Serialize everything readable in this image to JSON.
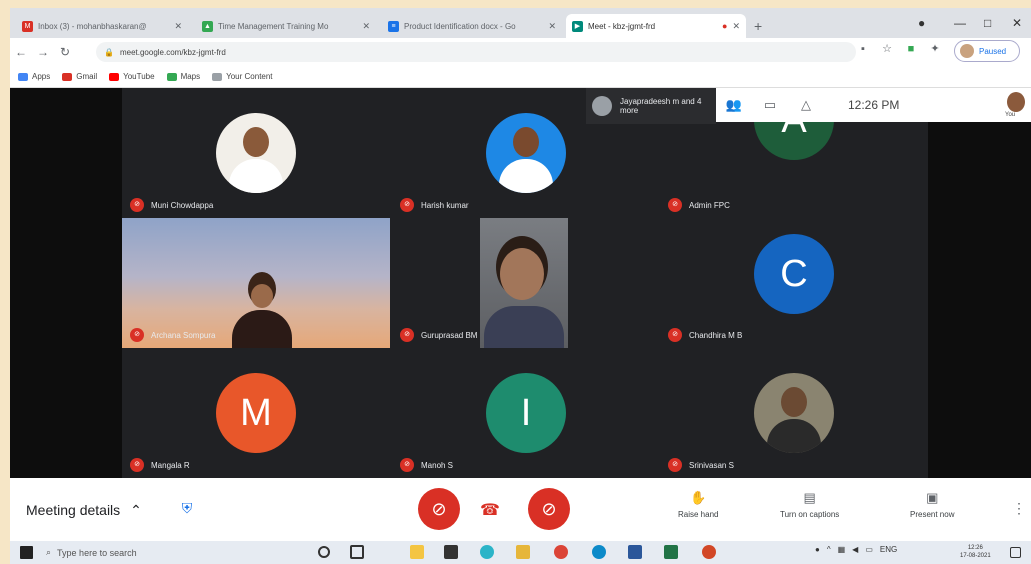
{
  "browser": {
    "tabs": [
      {
        "label": "Inbox (3) - mohanbhaskaran@",
        "icon": "gmail-icon",
        "color": "#d93025"
      },
      {
        "label": "Time Management Training Mo",
        "icon": "drive-icon",
        "color": "#34a853"
      },
      {
        "label": "Product Identification docx - Go",
        "icon": "docs-icon",
        "color": "#1a73e8"
      },
      {
        "label": "Meet - kbz-jgmt-frd",
        "icon": "meet-icon",
        "color": "#00897b"
      }
    ],
    "url": "meet.google.com/kbz-jgmt-frd",
    "profile_label": "Paused",
    "bookmarks": [
      {
        "label": "Apps",
        "color": "#4285f4"
      },
      {
        "label": "Gmail",
        "color": "#d93025"
      },
      {
        "label": "YouTube",
        "color": "#ff0000"
      },
      {
        "label": "Maps",
        "color": "#34a853"
      },
      {
        "label": "Your Content",
        "color": "#9aa0a6"
      }
    ]
  },
  "meet": {
    "participants_toast": "Jayapradeesh m and 4 more",
    "time": "12:26 PM",
    "self_label": "You",
    "tiles": [
      {
        "name": "Muni Chowdappa",
        "type": "photo",
        "color": "#f2efe9",
        "skin": "#8a5a3a",
        "shirt": "#ffffff"
      },
      {
        "name": "Harish kumar",
        "type": "photo",
        "color": "#1e88e5",
        "skin": "#7a4a2e",
        "shirt": "#ffffff"
      },
      {
        "name": "Admin FPC",
        "type": "letter",
        "letter": "A",
        "color": "#1e5d3a"
      },
      {
        "name": "Archana Sompura",
        "type": "sunset"
      },
      {
        "name": "Guruprasad BM",
        "type": "camera"
      },
      {
        "name": "Chandhira M B",
        "type": "letter",
        "letter": "C",
        "color": "#1565c0"
      },
      {
        "name": "Mangala R",
        "type": "letter",
        "letter": "M",
        "color": "#e8572a"
      },
      {
        "name": "Manoh S",
        "type": "letter",
        "letter": "I",
        "color": "#1e8c6e"
      },
      {
        "name": "Srinivasan S",
        "type": "photo",
        "color": "#8a8470",
        "skin": "#6b4a33",
        "shirt": "#2a2a2a"
      }
    ]
  },
  "controls": {
    "meeting_details": "Meeting details",
    "raise_hand": "Raise hand",
    "captions": "Turn on captions",
    "present": "Present now"
  },
  "taskbar": {
    "search_placeholder": "Type here to search",
    "time": "12:26",
    "date": "17-08-2021",
    "lang": "ENG"
  }
}
